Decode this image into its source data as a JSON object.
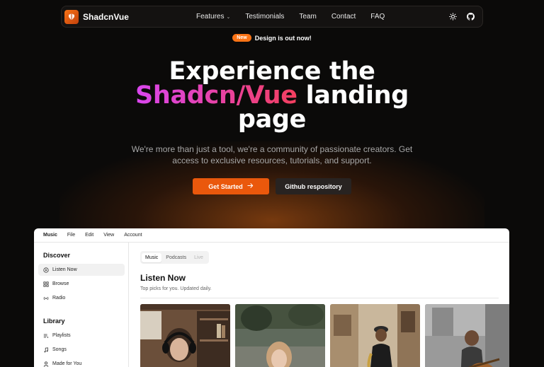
{
  "nav": {
    "brand": "ShadcnVue",
    "links": [
      "Features",
      "Testimonials",
      "Team",
      "Contact",
      "FAQ"
    ],
    "icons": [
      "sun-icon",
      "github-icon"
    ]
  },
  "announcement": {
    "badge": "New",
    "text": "Design is out now!"
  },
  "hero": {
    "line1": "Experience the",
    "highlight": "Shadcn/Vue",
    "line2_rest": " landing",
    "line3": "page",
    "subtitle": "We're more than just a tool, we're a community of passionate creators. Get access to exclusive resources, tutorials, and support.",
    "primary_button": "Get Started",
    "secondary_button": "Github respository"
  },
  "colors": {
    "accent": "#f97316",
    "background": "#0b0a09",
    "gradient_start": "#d946ef",
    "gradient_end": "#f43f5e"
  },
  "app": {
    "menu": [
      "Music",
      "File",
      "Edit",
      "View",
      "Account"
    ],
    "discover_title": "Discover",
    "discover_items": [
      {
        "label": "Listen Now",
        "icon": "play-circle-icon"
      },
      {
        "label": "Browse",
        "icon": "grid-icon"
      },
      {
        "label": "Radio",
        "icon": "radio-icon"
      }
    ],
    "library_title": "Library",
    "library_items": [
      {
        "label": "Playlists",
        "icon": "playlist-icon"
      },
      {
        "label": "Songs",
        "icon": "music-note-icon"
      },
      {
        "label": "Made for You",
        "icon": "user-icon"
      }
    ],
    "tabs": [
      "Music",
      "Podcasts",
      "Live"
    ],
    "title": "Listen Now",
    "subtitle": "Top picks for you. Updated daily."
  }
}
